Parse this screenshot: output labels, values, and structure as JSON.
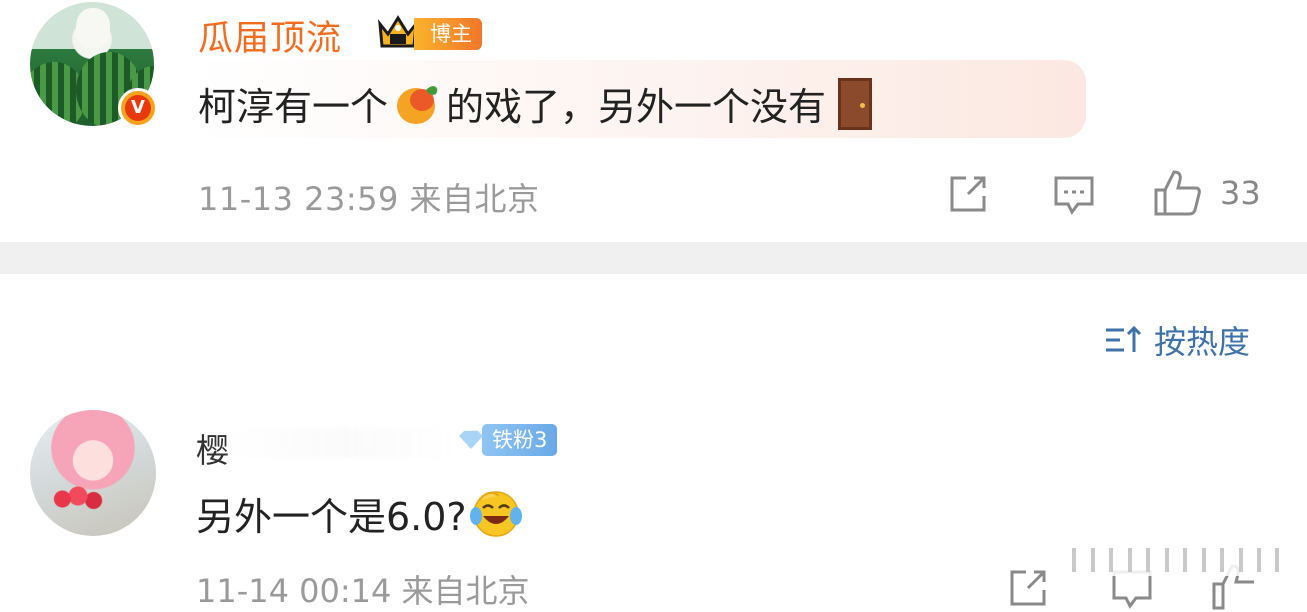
{
  "comments": [
    {
      "username": "瓜届顶流",
      "badge": "博主",
      "text_before_emoji": "柯淳有一个",
      "emoji_1": "mango-emoji",
      "text_after_emoji": "的戏了，另外一个没有",
      "emoji_2": "door-emoji",
      "meta": "11-13 23:59 来自北京",
      "like_count": "33",
      "verified": true
    },
    {
      "username": "樱",
      "badge": "铁粉3",
      "text": "另外一个是6.0?",
      "emoji": "laughing-tears-emoji",
      "meta": "11-14 00:14 来自北京"
    }
  ],
  "sort": {
    "label": "按热度"
  },
  "colors": {
    "username_orange": "#f26c20",
    "meta_gray": "#9a9a9a",
    "sort_blue": "#3f72a8",
    "divider": "#f0f0f0"
  }
}
